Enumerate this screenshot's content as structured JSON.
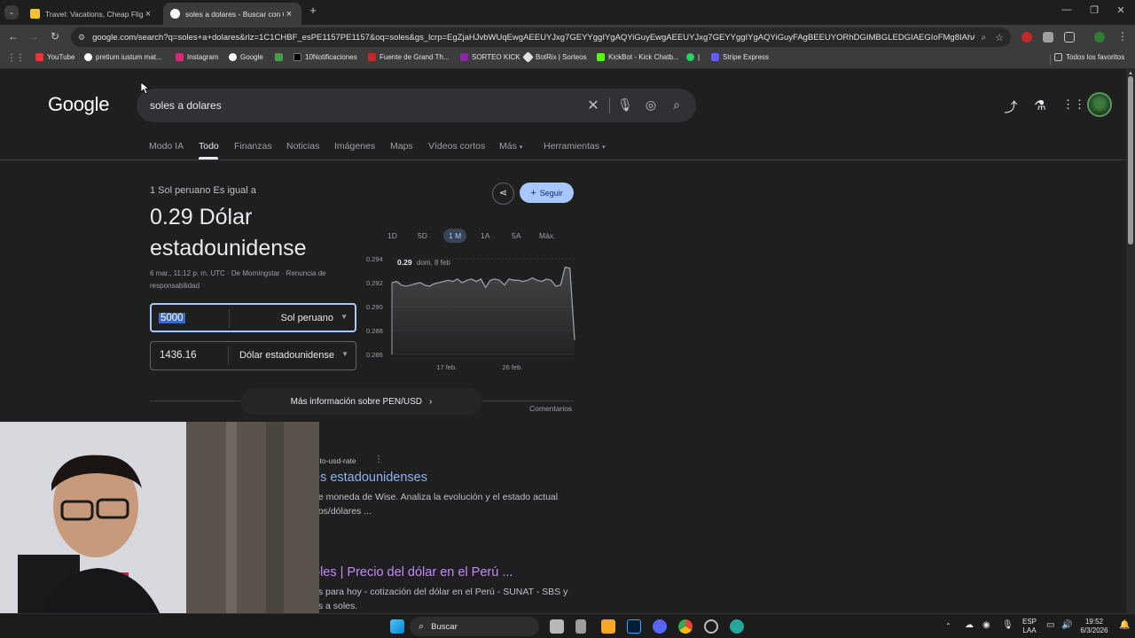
{
  "browser": {
    "tabs": [
      {
        "title": "Travel: Vacations, Cheap Flights",
        "active": false
      },
      {
        "title": "soles a dolares - Buscar con Google",
        "active": true
      }
    ],
    "new_tab": "+",
    "url": "google.com/search?q=soles+a+dolares&rlz=1C1CHBF_esPE1157PE1157&oq=soles&gs_lcrp=EgZjaHJvbWUqEwgAEEUYJxg7GEYYggIYgAQYiGuyEwgAEEUYJxg7GEYYggIYgAQYiGuyFAgBEEUYORhDGIMBGLEDGIAEGIoFMg8IAhAAGEMYsQMY...",
    "bookmarks": [
      "YouTube",
      "pretium iustum mat...",
      "Instagram",
      "Google",
      "",
      "10Notificaciones",
      "Fuente de Grand Th...",
      "SORTEO KICK",
      "BotRix | Sorteos",
      "KickBot - Kick Chatb...",
      "|",
      "Stripe Express"
    ],
    "all_bookmarks": "Todos los favoritos"
  },
  "search": {
    "logo": "Google",
    "query": "soles a dolares",
    "tabs": [
      "Modo IA",
      "Todo",
      "Finanzas",
      "Noticias",
      "Imágenes",
      "Maps",
      "Vídeos cortos",
      "Más",
      "Herramientas"
    ]
  },
  "converter": {
    "equals_label": "1 Sol peruano Es igual a",
    "result": "0.29 Dólar estadounidense",
    "meta": "6 mar., 11:12 p. m. UTC · De Morningstar · Renuncia de responsabilidad",
    "follow_label": "Seguir",
    "from_value": "5000",
    "from_unit": "Sol peruano",
    "to_value": "1436.16",
    "to_unit": "Dólar estadounidense",
    "more_info": "Más información sobre PEN/USD",
    "feedback": "Comentarios",
    "ranges": [
      "1D",
      "5D",
      "1 M",
      "1A",
      "5A",
      "Máx."
    ],
    "active_range": "1 M"
  },
  "chart_data": {
    "type": "area",
    "tooltip_value": "0.29",
    "tooltip_date": "dom, 8 feb",
    "y_ticks": [
      "0.294",
      "0.292",
      "0.290",
      "0.288",
      "0.286"
    ],
    "ylim": [
      0.286,
      0.294
    ],
    "x_ticks": [
      "17 feb.",
      "26 feb."
    ],
    "values": [
      0.292,
      0.2921,
      0.2918,
      0.2917,
      0.2918,
      0.2919,
      0.292,
      0.2918,
      0.2917,
      0.2919,
      0.292,
      0.2921,
      0.2922,
      0.2921,
      0.2923,
      0.292,
      0.2922,
      0.2923,
      0.2921,
      0.2923,
      0.2916,
      0.2922,
      0.2923,
      0.2922,
      0.2918,
      0.2923,
      0.2922,
      0.2922,
      0.2921,
      0.2922,
      0.2924,
      0.2922,
      0.2921,
      0.2923,
      0.2922,
      0.2917,
      0.2918,
      0.2933,
      0.2932,
      0.2872
    ]
  },
  "results": [
    {
      "url": "n-to-usd-rate",
      "title": "es estadounidenses",
      "snippet": "de moneda de Wise. Analiza la evolución y el estado actual nos/dólares ..."
    },
    {
      "title": "oles | Precio del dólar en el Perú ...",
      "snippet": "es para hoy - cotización del dólar en el Perú - SUNAT - SBS y es a soles."
    }
  ],
  "taskbar": {
    "search_placeholder": "Buscar",
    "lang": "ESP",
    "lang2": "LAA",
    "time": "19:52",
    "date": "6/3/2026"
  },
  "colors": {
    "accent": "#a8c7fa",
    "link": "#8ab4f8",
    "visited": "#c58af9",
    "chart_line": "#9aa0a6"
  }
}
